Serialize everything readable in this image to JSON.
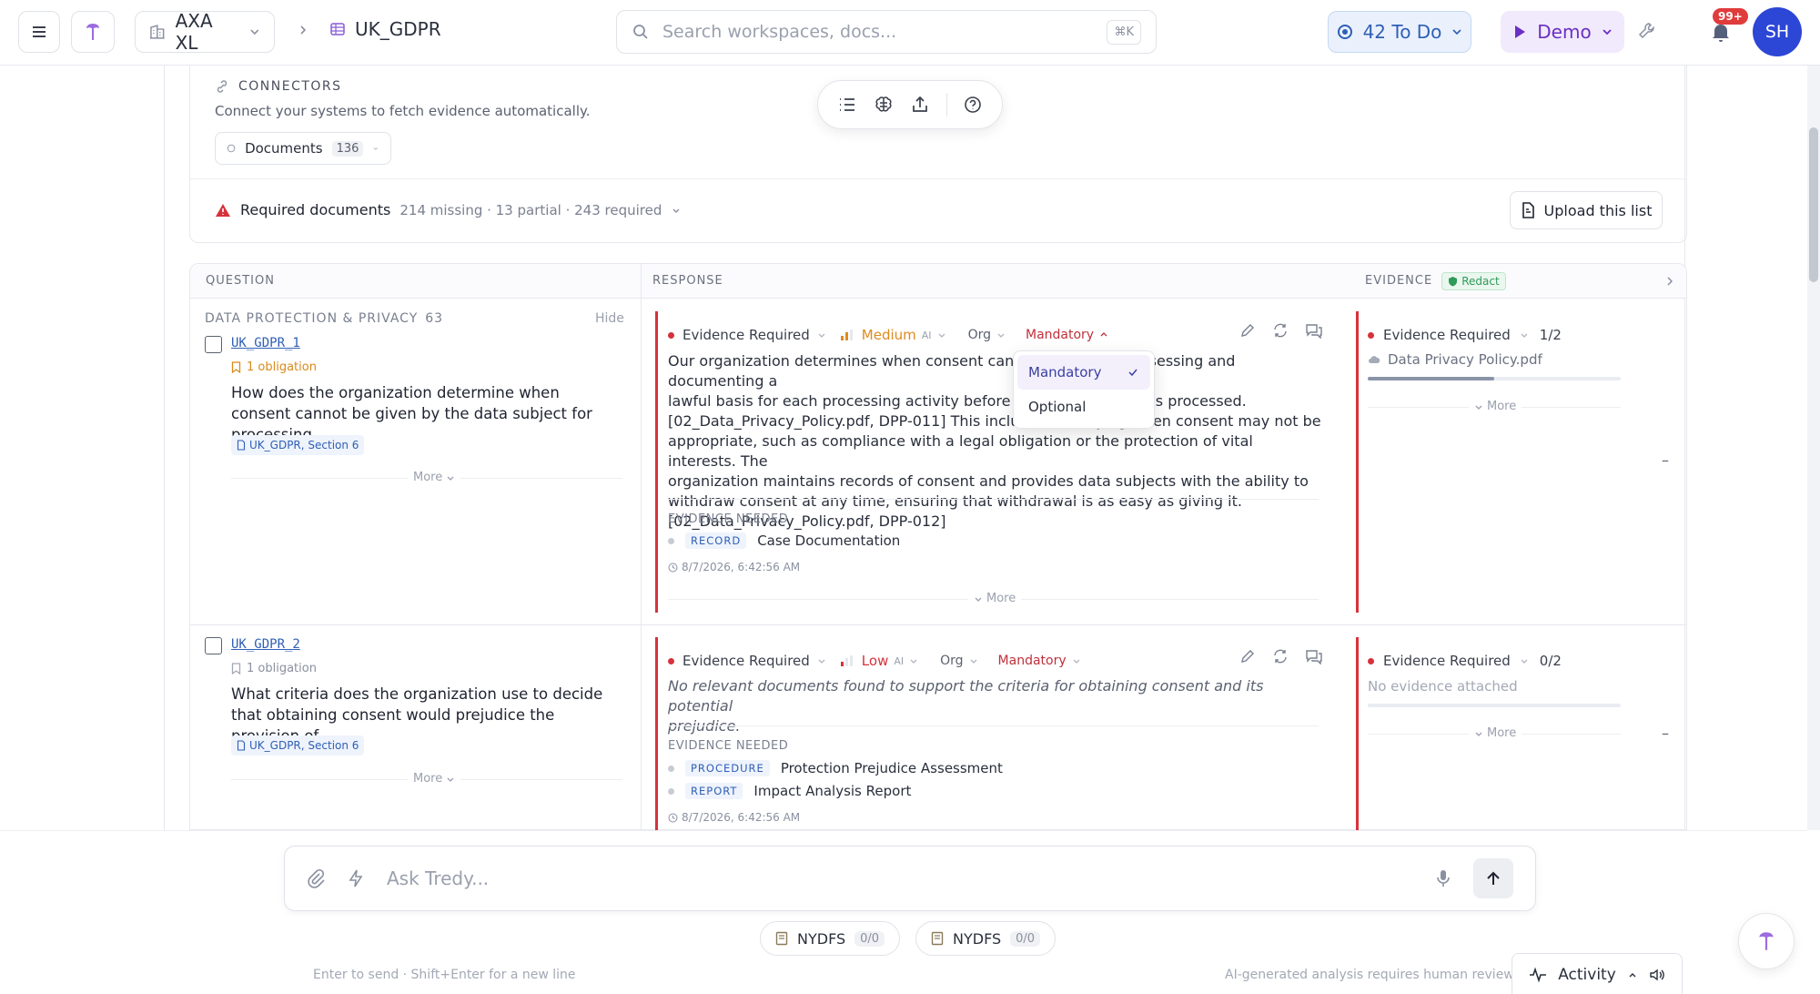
{
  "topbar": {
    "org": "AXA XL",
    "doc": "UK_GDPR",
    "search_placeholder": "Search workspaces, docs...",
    "search_kbd": "⌘K",
    "todo_label": "42 To Do",
    "demo_label": "Demo",
    "notif_badge": "99+",
    "avatar_initials": "SH"
  },
  "connectors": {
    "title": "CONNECTORS",
    "subtitle": "Connect your systems to fetch evidence automatically.",
    "documents_label": "Documents",
    "documents_count": "136"
  },
  "required_docs": {
    "label": "Required documents",
    "meta": "214 missing · 13 partial · 243 required",
    "upload_label": "Upload this list"
  },
  "table": {
    "headers": {
      "question": "QUESTION",
      "response": "RESPONSE",
      "evidence": "EVIDENCE",
      "redact": "Redact"
    },
    "section": {
      "name": "DATA PROTECTION & PRIVACY",
      "count": "63",
      "hide": "Hide"
    },
    "rows": [
      {
        "id": "UK_GDPR_1",
        "obligation": "1 obligation",
        "question": "How does the organization determine when consent cannot be given by the data subject for processing…",
        "ref": "UK_GDPR, Section 6",
        "more": "More",
        "resp_status": "Evidence Required",
        "risk": "Medium",
        "ai": "AI",
        "scope": "Org",
        "mandatory": "Mandatory",
        "response_lines": [
          "Our organization determines when consent cannot be given by assessing and documenting a",
          "lawful basis for each processing activity before any personal data is processed.",
          "[02_Data_Privacy_Policy.pdf, DPP-011] This includes identifying when consent may not be",
          "appropriate, such as compliance with a legal obligation or the protection of vital interests. The",
          "organization maintains records of consent and provides data subjects with the ability to",
          "withdraw consent at any time, ensuring that withdrawal is as easy as giving it.",
          "[02_Data_Privacy_Policy.pdf, DPP-012]"
        ],
        "evidence_needed_label": "EVIDENCE NEEDED",
        "evidence_needed": [
          {
            "type": "RECORD",
            "name": "Case Documentation"
          }
        ],
        "timestamp": "8/7/2026, 6:42:56 AM",
        "ev_status": "Evidence Required",
        "ev_count": "1/2",
        "ev_file": "Data Privacy Policy.pdf",
        "ev_progress": 0.5,
        "dash": "–"
      },
      {
        "id": "UK_GDPR_2",
        "obligation": "1 obligation",
        "question": "What criteria does the organization use to decide that obtaining consent would prejudice the provision of…",
        "ref": "UK_GDPR, Section 6",
        "more": "More",
        "resp_status": "Evidence Required",
        "risk": "Low",
        "ai": "AI",
        "scope": "Org",
        "mandatory": "Mandatory",
        "response_lines": [
          "No relevant documents found to support the criteria for obtaining consent and its potential",
          "prejudice."
        ],
        "evidence_needed_label": "EVIDENCE NEEDED",
        "evidence_needed": [
          {
            "type": "PROCEDURE",
            "name": "Protection Prejudice Assessment"
          },
          {
            "type": "REPORT",
            "name": "Impact Analysis Report"
          }
        ],
        "timestamp": "8/7/2026, 6:42:56 AM",
        "ev_status": "Evidence Required",
        "ev_count": "0/2",
        "ev_file": "No evidence attached",
        "ev_progress": 0,
        "dash": "–"
      }
    ]
  },
  "dropdown": {
    "options": [
      "Mandatory",
      "Optional"
    ],
    "selected": "Mandatory"
  },
  "chat": {
    "placeholder": "Ask Tredy...",
    "chips": [
      {
        "label": "NYDFS",
        "count": "0/0"
      },
      {
        "label": "NYDFS",
        "count": "0/0"
      }
    ],
    "hint": "Enter to send · Shift+Enter for a new line",
    "ai_note": "AI-generated analysis requires human review.",
    "activity_label": "Activity"
  },
  "colors": {
    "accent_blue": "#2f5fb5",
    "accent_purple": "#6a2fc4",
    "required_red": "#d6323c",
    "medium_orange": "#e08a1e",
    "low_red": "#d6323c",
    "avatar_bg": "#2c46d6"
  },
  "icons": [
    "menu-icon",
    "logo-icon",
    "building-icon",
    "chevron-down-icon",
    "chevron-right-icon",
    "table-icon",
    "search-icon",
    "target-icon",
    "play-icon",
    "wrench-icon",
    "bell-icon",
    "link-icon",
    "alert-icon",
    "file-icon",
    "list-icon",
    "brain-icon",
    "share-icon",
    "help-icon",
    "bookmark-icon",
    "edit-icon",
    "refresh-icon",
    "comment-icon",
    "clock-icon",
    "paperclip-icon",
    "bolt-icon",
    "mic-icon",
    "arrow-up-icon",
    "activity-icon",
    "speaker-icon",
    "shield-icon"
  ]
}
